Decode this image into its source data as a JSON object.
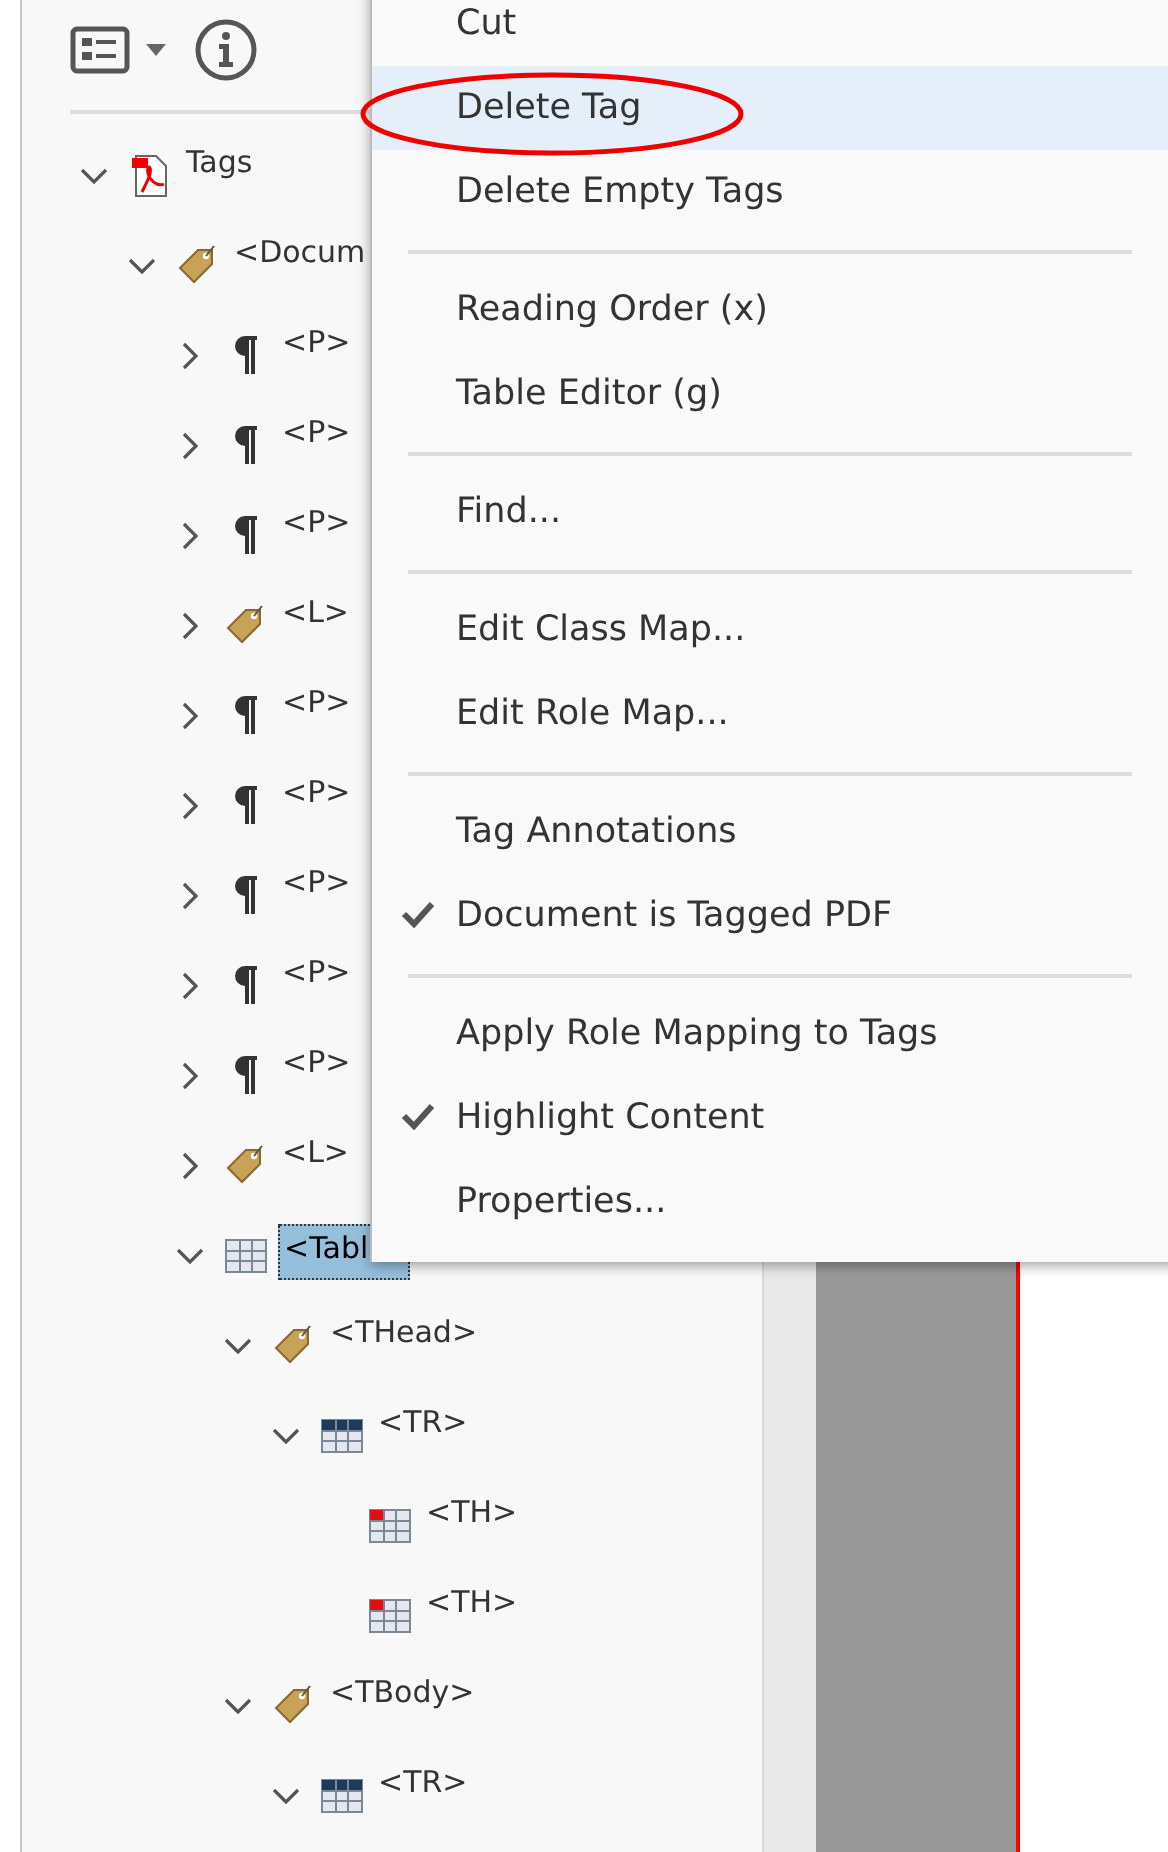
{
  "tree": [
    {
      "label": "Tags",
      "kind": "pdf",
      "has_children": true,
      "expanded": true,
      "selected": false,
      "children": [
        {
          "label": "<Docum",
          "kind": "tag",
          "has_children": true,
          "expanded": true,
          "selected": false,
          "children": [
            {
              "label": "<P>",
              "kind": "para",
              "has_children": true,
              "expanded": false,
              "selected": false
            },
            {
              "label": "<P>",
              "kind": "para",
              "has_children": true,
              "expanded": false,
              "selected": false
            },
            {
              "label": "<P>",
              "kind": "para",
              "has_children": true,
              "expanded": false,
              "selected": false
            },
            {
              "label": "<L>",
              "kind": "tag",
              "has_children": true,
              "expanded": false,
              "selected": false
            },
            {
              "label": "<P>",
              "kind": "para",
              "has_children": true,
              "expanded": false,
              "selected": false
            },
            {
              "label": "<P>",
              "kind": "para",
              "has_children": true,
              "expanded": false,
              "selected": false
            },
            {
              "label": "<P>",
              "kind": "para",
              "has_children": true,
              "expanded": false,
              "selected": false
            },
            {
              "label": "<P>",
              "kind": "para",
              "has_children": true,
              "expanded": false,
              "selected": false
            },
            {
              "label": "<P>",
              "kind": "para",
              "has_children": true,
              "expanded": false,
              "selected": false
            },
            {
              "label": "<L>",
              "kind": "tag",
              "has_children": true,
              "expanded": false,
              "selected": false
            },
            {
              "label": "<Tabl",
              "kind": "table",
              "has_children": true,
              "expanded": true,
              "selected": true,
              "children": [
                {
                  "label": "<THead>",
                  "kind": "tag",
                  "has_children": true,
                  "expanded": true,
                  "selected": false,
                  "children": [
                    {
                      "label": "<TR>",
                      "kind": "row",
                      "has_children": true,
                      "expanded": true,
                      "selected": false,
                      "children": [
                        {
                          "label": "<TH>",
                          "kind": "cell",
                          "has_children": false,
                          "selected": false
                        },
                        {
                          "label": "<TH>",
                          "kind": "cell",
                          "has_children": false,
                          "selected": false
                        }
                      ]
                    }
                  ]
                },
                {
                  "label": "<TBody>",
                  "kind": "tag",
                  "has_children": true,
                  "expanded": true,
                  "selected": false,
                  "children": [
                    {
                      "label": "<TR>",
                      "kind": "row",
                      "has_children": true,
                      "expanded": true,
                      "selected": false
                    }
                  ]
                }
              ]
            }
          ]
        }
      ]
    }
  ],
  "context_menu": [
    {
      "kind": "item",
      "label": "Cut",
      "checked": false,
      "selected": false
    },
    {
      "kind": "item",
      "label": "Delete Tag",
      "checked": false,
      "selected": true,
      "circled": true
    },
    {
      "kind": "item",
      "label": "Delete Empty Tags",
      "checked": false,
      "selected": false
    },
    {
      "kind": "separator"
    },
    {
      "kind": "item",
      "label": "Reading Order (x)",
      "checked": false,
      "selected": false
    },
    {
      "kind": "item",
      "label": "Table Editor (g)",
      "checked": false,
      "selected": false
    },
    {
      "kind": "separator"
    },
    {
      "kind": "item",
      "label": "Find...",
      "checked": false,
      "selected": false
    },
    {
      "kind": "separator"
    },
    {
      "kind": "item",
      "label": "Edit Class Map...",
      "checked": false,
      "selected": false
    },
    {
      "kind": "item",
      "label": "Edit Role Map...",
      "checked": false,
      "selected": false
    },
    {
      "kind": "separator"
    },
    {
      "kind": "item",
      "label": "Tag Annotations",
      "checked": false,
      "selected": false
    },
    {
      "kind": "item",
      "label": "Document is Tagged PDF",
      "checked": true,
      "selected": false
    },
    {
      "kind": "separator"
    },
    {
      "kind": "item",
      "label": "Apply Role Mapping to Tags",
      "checked": false,
      "selected": false
    },
    {
      "kind": "item",
      "label": "Highlight Content",
      "checked": true,
      "selected": false
    },
    {
      "kind": "item",
      "label": "Properties...",
      "checked": false,
      "selected": false
    }
  ]
}
